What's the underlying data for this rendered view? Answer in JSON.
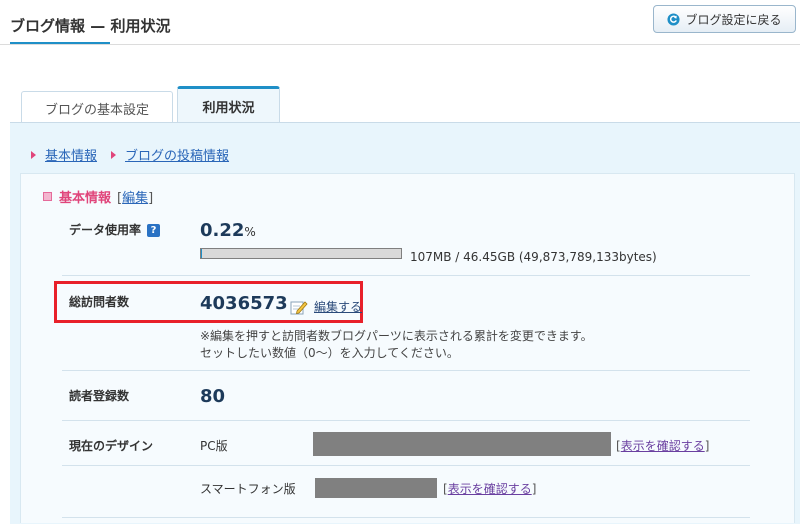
{
  "header": {
    "title": "ブログ情報 — 利用状況",
    "back_button": "ブログ設定に戻る"
  },
  "tabs": [
    {
      "label": "ブログの基本設定",
      "active": false
    },
    {
      "label": "利用状況",
      "active": true
    }
  ],
  "subnav": [
    "基本情報",
    "ブログの投稿情報"
  ],
  "section": {
    "title": "基本情報",
    "edit_open": "[",
    "edit_label": "編集",
    "edit_close": "]"
  },
  "data_usage": {
    "label": "データ使用率",
    "help": "?",
    "value": "0.22",
    "unit": "%",
    "fraction": 0.0022,
    "detail": "107MB / 46.45GB (49,873,789,133bytes)"
  },
  "visitors": {
    "label": "総訪問者数",
    "value": "4036573",
    "edit": "編集する",
    "note1": "※編集を押すと訪問者数ブログパーツに表示される累計を変更できます。",
    "note2": "セットしたい数値（0～）を入力してください。"
  },
  "subscribers": {
    "label": "読者登録数",
    "value": "80"
  },
  "design": {
    "label": "現在のデザイン",
    "pc_label": "PC版",
    "sp_label": "スマートフォン版",
    "confirm": "表示を確認する",
    "open": "[",
    "close": "]"
  },
  "colors": {
    "accent": "#1f8fc7",
    "pink": "#e0457b",
    "highlight": "#e8202a"
  }
}
